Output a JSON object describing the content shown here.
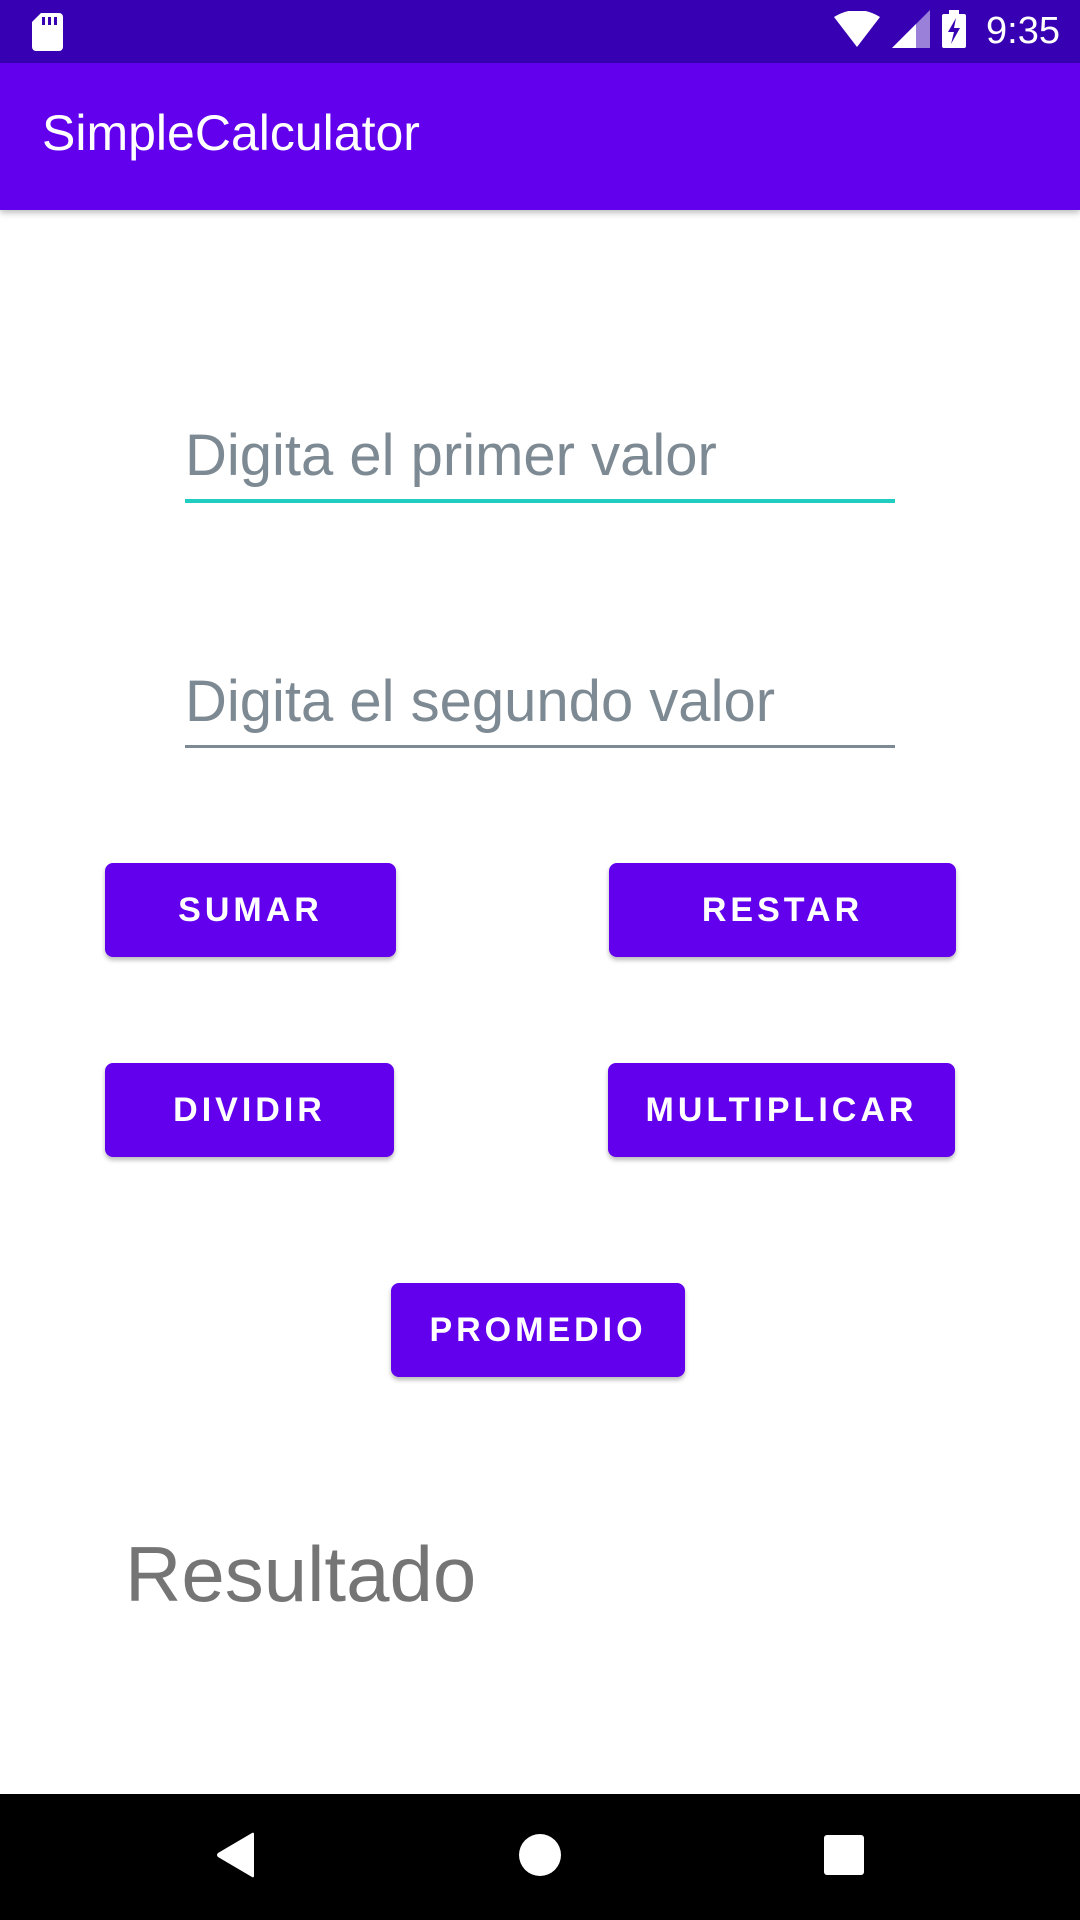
{
  "status_bar": {
    "time": "9:35",
    "icons": [
      "sd-card-icon",
      "wifi-icon",
      "cell-signal-icon",
      "battery-charging-icon"
    ]
  },
  "app_bar": {
    "title": "SimpleCalculator"
  },
  "inputs": {
    "first": {
      "placeholder": "Digita el primer valor",
      "value": ""
    },
    "second": {
      "placeholder": "Digita el segundo valor",
      "value": ""
    }
  },
  "buttons": {
    "sumar": "SUMAR",
    "restar": "RESTAR",
    "dividir": "DIVIDIR",
    "multiplicar": "MULTIPLICAR",
    "promedio": "PROMEDIO"
  },
  "result": {
    "label": "Resultado"
  },
  "nav_bar": {
    "icons": [
      "back-icon",
      "home-icon",
      "recents-icon"
    ]
  },
  "colors": {
    "status_bar": "#3700b3",
    "primary": "#6200ee",
    "focus_accent": "#20cdc0",
    "hint_text": "#7d8a93",
    "result_text": "#757575"
  }
}
